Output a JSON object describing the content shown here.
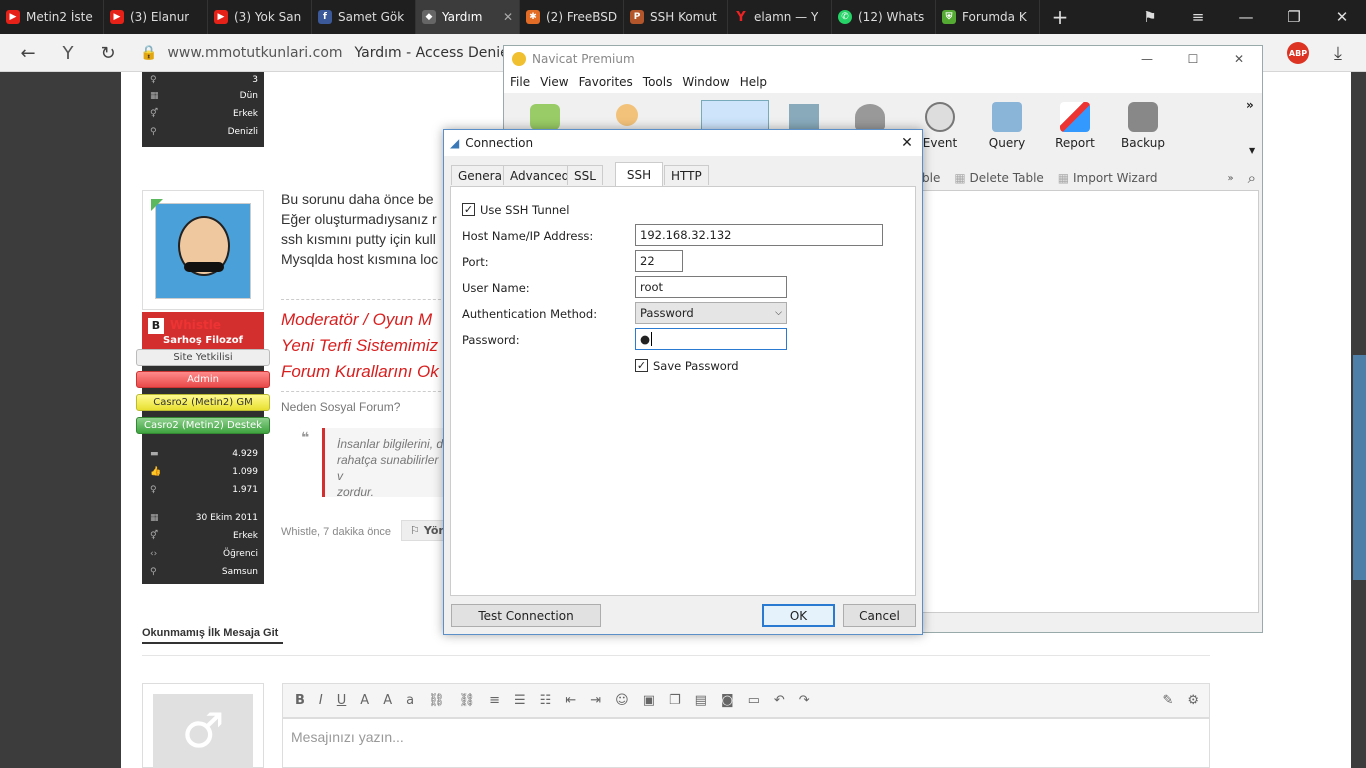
{
  "browser": {
    "tabs": [
      {
        "label": "Metin2 İste",
        "icon": "youtube-icon",
        "color": "#e62117"
      },
      {
        "label": "(3) Elanur",
        "icon": "youtube-icon",
        "color": "#e62117"
      },
      {
        "label": "(3) Yok San",
        "icon": "youtube-icon",
        "color": "#e62117"
      },
      {
        "label": "Samet Gök",
        "icon": "facebook-icon",
        "color": "#3b5998"
      },
      {
        "label": "Yardım",
        "icon": "diamond-icon",
        "color": "#666"
      },
      {
        "label": "(2) FreeBSD",
        "icon": "freebsd-icon",
        "color": "#e26b25"
      },
      {
        "label": "SSH Komut",
        "icon": "search-p-icon",
        "color": "#b3562b"
      },
      {
        "label": "elamn — Y",
        "icon": "yandex-icon",
        "color": "#e22"
      },
      {
        "label": "(12) Whats",
        "icon": "whatsapp-icon",
        "color": "#25d366"
      },
      {
        "label": "Forumda K",
        "icon": "shield-icon",
        "color": "#5a3"
      }
    ],
    "url_domain": "www.mmotutkunlari.com",
    "url_title": "Yardım - Access Denied",
    "abp": "ABP"
  },
  "page": {
    "user_top": {
      "r1": "3",
      "r2": "Dün",
      "r3": "Erkek",
      "r4": "Denizli"
    },
    "post_lines": [
      "Bu sorunu daha önce be",
      "Eğer oluşturmadıysanız r",
      "ssh kısmını putty için kull",
      "Mysqlda host kısmına loc"
    ],
    "red_lines": [
      "Moderatör / Oyun M",
      "Yeni Terfi Sistemimiz",
      "Forum Kurallarını Ok"
    ],
    "sig": "Neden Sosyal Forum?",
    "quote_lines": [
      "İnsanlar bilgilerini, d",
      "rahatça sunabilirler v",
      "zordur."
    ],
    "poster_name": "Whistle",
    "poster_title": "Sarhoş Filozof",
    "badges": [
      "Site Yetkilisi",
      "Admin",
      "Casro2 (Metin2) GM",
      "Casro2 (Metin2) Destek"
    ],
    "stats": [
      "4.929",
      "1.099",
      "1.971"
    ],
    "joined": "30 Ekim 2011",
    "gender": "Erkek",
    "job": "Öğrenci",
    "city": "Samsun",
    "post_meta": "Whistle, 7 dakika önce",
    "reply_btn": "Yön",
    "unread": "Okunmamış İlk Mesaja Git",
    "editor_placeholder": "Mesajınızı yazın..."
  },
  "navicat": {
    "title": "Navicat Premium",
    "menu": [
      "File",
      "View",
      "Favorites",
      "Tools",
      "Window",
      "Help"
    ],
    "tools": [
      "Event",
      "Query",
      "Report",
      "Backup"
    ],
    "sub": [
      "ble",
      "Delete Table",
      "Import Wizard"
    ]
  },
  "dialog": {
    "title": "Connection",
    "tabs": [
      "General",
      "Advanced",
      "SSL",
      "SSH",
      "HTTP"
    ],
    "use_ssh": "Use SSH Tunnel",
    "host_label": "Host Name/IP Address:",
    "host": "192.168.32.132",
    "port_label": "Port:",
    "port": "22",
    "user_label": "User Name:",
    "user": "root",
    "auth_label": "Authentication Method:",
    "auth": "Password",
    "pass_label": "Password:",
    "pass": "●",
    "save_pass": "Save Password",
    "test": "Test Connection",
    "ok": "OK",
    "cancel": "Cancel"
  }
}
